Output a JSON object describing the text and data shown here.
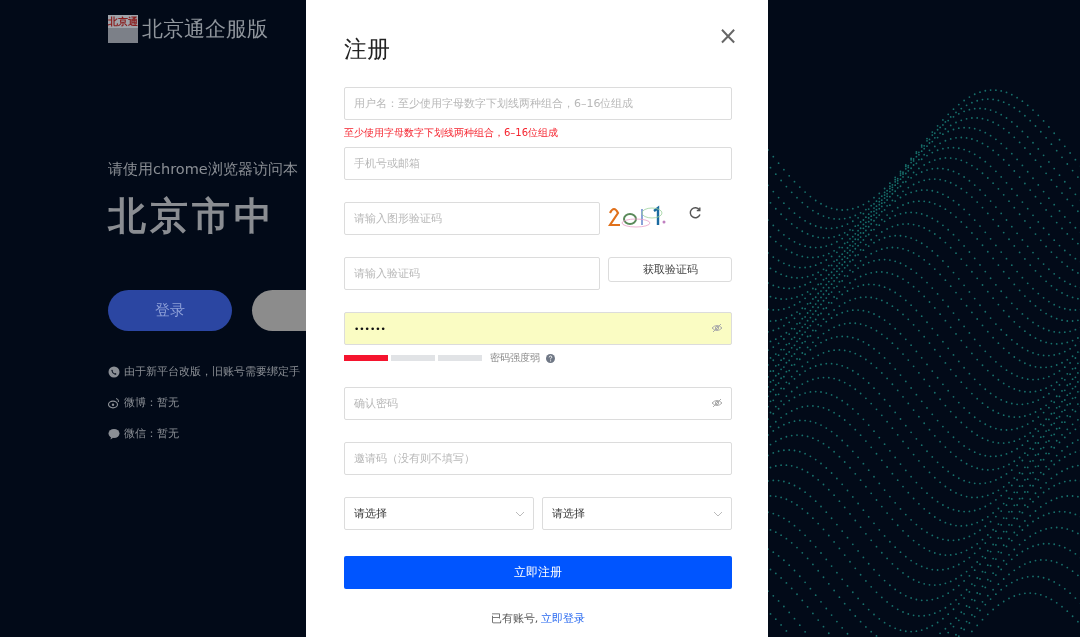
{
  "background": {
    "brand": {
      "logo": "北京通",
      "name": "北京通企服版"
    },
    "notice": "请使用chrome浏览器访问本",
    "headline": "北京市中",
    "buttons": [
      {
        "label": "登录",
        "kind": "primary"
      },
      {
        "kind": "secondary"
      }
    ],
    "info": [
      {
        "kind": "phone",
        "text": "由于新平台改版，旧账号需要绑定手"
      },
      {
        "kind": "weibo",
        "text": "微博：暂无"
      },
      {
        "kind": "wechat",
        "text": "微信：暂无"
      }
    ]
  },
  "dialog": {
    "title": "注册",
    "close": "×",
    "fields": [
      {
        "kind": "text",
        "placeholder": "用户名：至少使用字母数字下划线两种组合，6–16位组成",
        "error": "至少使用字母数字下划线两种组合，6–16位组成"
      },
      {
        "kind": "text",
        "placeholder": "手机号或邮箱"
      },
      {
        "kind": "captcha",
        "placeholder": "请输入图形验证码"
      },
      {
        "kind": "sms",
        "placeholder": "请输入验证码",
        "button": "获取验证码"
      },
      {
        "kind": "password",
        "value": "••••••",
        "autofilled": true,
        "strength": {
          "segments": [
            {
              "filled": true
            },
            {
              "filled": false
            },
            {
              "filled": false
            }
          ],
          "label": "密码强度弱"
        }
      },
      {
        "kind": "password",
        "placeholder": "确认密码",
        "autofilled": false
      },
      {
        "kind": "text",
        "placeholder": "邀请码（没有则不填写）"
      }
    ],
    "selects": [
      {
        "value": "请选择"
      },
      {
        "value": "请选择"
      }
    ],
    "submit": "立即注册",
    "footer": {
      "text": "已有账号,",
      "link": "立即登录"
    }
  }
}
